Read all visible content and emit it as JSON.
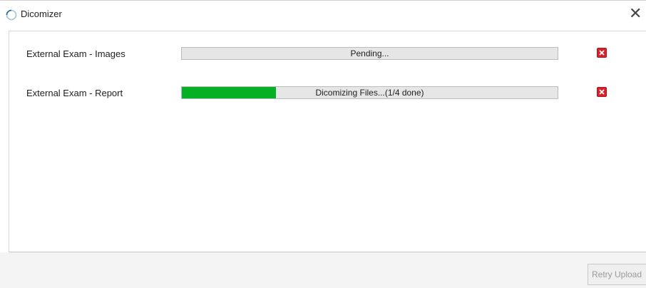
{
  "window": {
    "title": "Dicomizer",
    "close_glyph": "✕"
  },
  "icons": {
    "app": "circular-progress-icon",
    "remove": "close-red-icon"
  },
  "colors": {
    "progress_fill": "#06b025",
    "remove_button": "#d9202a"
  },
  "items": [
    {
      "label": "External Exam - Images",
      "status": "Pending...",
      "progress": 0
    },
    {
      "label": "External Exam - Report",
      "status": "Dicomizing Files...(1/4 done)",
      "progress": 0.25
    }
  ],
  "footer": {
    "retry_label": "Retry Upload"
  }
}
